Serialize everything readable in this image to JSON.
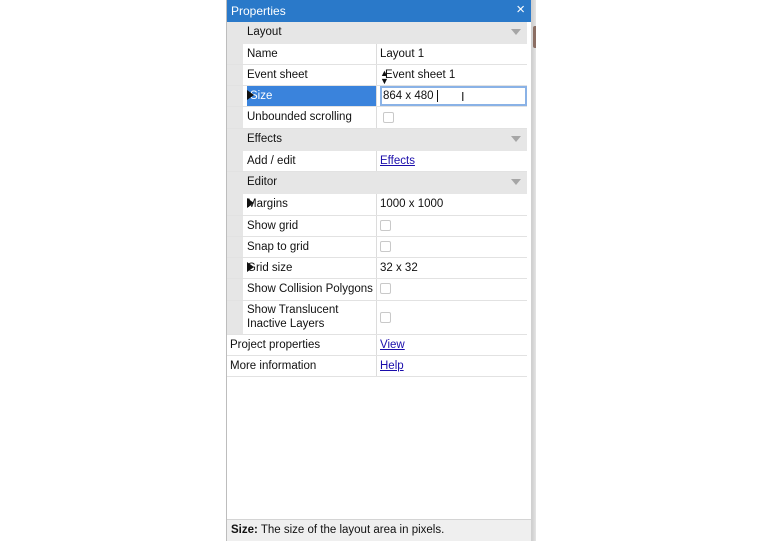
{
  "panel": {
    "title": "Properties",
    "close_glyph": "×"
  },
  "categories": {
    "layout": "Layout",
    "effects": "Effects",
    "editor": "Editor"
  },
  "rows": {
    "name": {
      "label": "Name",
      "value": "Layout 1"
    },
    "event_sheet": {
      "label": "Event sheet",
      "value": "Event sheet 1"
    },
    "size": {
      "label": "Size",
      "value": "864 x 480"
    },
    "unbounded": {
      "label": "Unbounded scrolling",
      "checked": false
    },
    "add_edit": {
      "label": "Add / edit",
      "link": "Effects"
    },
    "margins": {
      "label": "Margins",
      "value": "1000 x 1000"
    },
    "show_grid": {
      "label": "Show grid",
      "checked": false
    },
    "snap_grid": {
      "label": "Snap to grid",
      "checked": false
    },
    "grid_size": {
      "label": "Grid size",
      "value": "32 x 32"
    },
    "collision": {
      "label": "Show Collision Polygons",
      "checked": false
    },
    "translucent": {
      "label_line1": "Show Translucent",
      "label_line2": "Inactive Layers",
      "checked": false
    },
    "project": {
      "label": "Project properties",
      "link": "View"
    },
    "more_info": {
      "label": "More information",
      "link": "Help"
    }
  },
  "status": {
    "bold": "Size:",
    "text": " The size of the layout area in pixels."
  },
  "colors": {
    "titlebar": "#2a79c9",
    "selected_row": "#3a83dc",
    "category_bg": "#e6e6e6",
    "link": "#1a0dab"
  }
}
